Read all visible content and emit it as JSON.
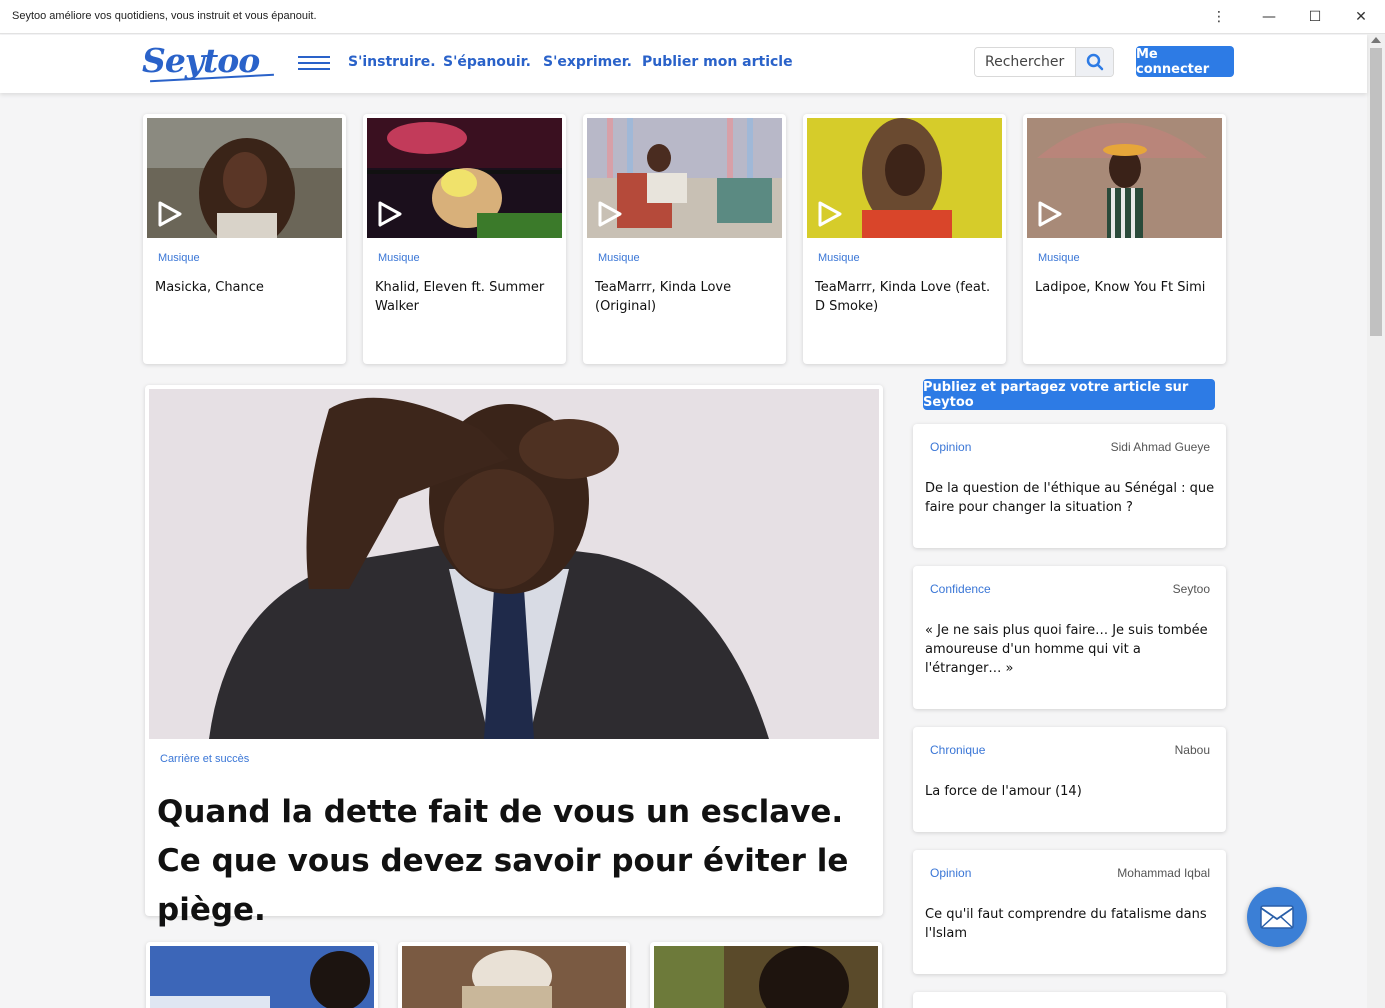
{
  "window": {
    "title": "Seytoo améliore vos quotidiens, vous instruit et vous épanouit.",
    "menu_glyph": "⋮",
    "minimize_glyph": "—",
    "maximize_glyph": "☐",
    "close_glyph": "✕"
  },
  "header": {
    "logo": "Seytoo",
    "nav": [
      "S'instruire.",
      "S'épanouir.",
      "S'exprimer.",
      "Publier mon article"
    ],
    "search_placeholder": "Rechercher",
    "login_label": "Me connecter",
    "accent_color": "#2a62c9",
    "button_color": "#2d7be5"
  },
  "music_videos": [
    {
      "category": "Musique",
      "title": "Masicka, Chance"
    },
    {
      "category": "Musique",
      "title": "Khalid, Eleven ft. Summer Walker"
    },
    {
      "category": "Musique",
      "title": "TeaMarrr, Kinda Love (Original)"
    },
    {
      "category": "Musique",
      "title": "TeaMarrr, Kinda Love (feat. D Smoke)"
    },
    {
      "category": "Musique",
      "title": "Ladipoe, Know You Ft Simi"
    }
  ],
  "featured": {
    "category": "Carrière et succès",
    "title": "Quand la dette fait de vous un esclave. Ce que vous devez savoir pour éviter le piège."
  },
  "publish_cta": "Publiez et partagez votre article sur Seytoo",
  "side_articles": [
    {
      "category": "Opinion",
      "author": "Sidi Ahmad Gueye",
      "title": "De la question de l'éthique au Sénégal : que faire pour changer la situation ?"
    },
    {
      "category": "Confidence",
      "author": "Seytoo",
      "title": "« Je ne sais plus quoi faire… Je suis tombée amoureuse d'un homme qui vit a l'étranger… »"
    },
    {
      "category": "Chronique",
      "author": "Nabou",
      "title": "La force de l'amour (14)"
    },
    {
      "category": "Opinion",
      "author": "Mohammad Iqbal",
      "title": "Ce qu'il faut comprendre du fatalisme dans l'Islam"
    }
  ]
}
